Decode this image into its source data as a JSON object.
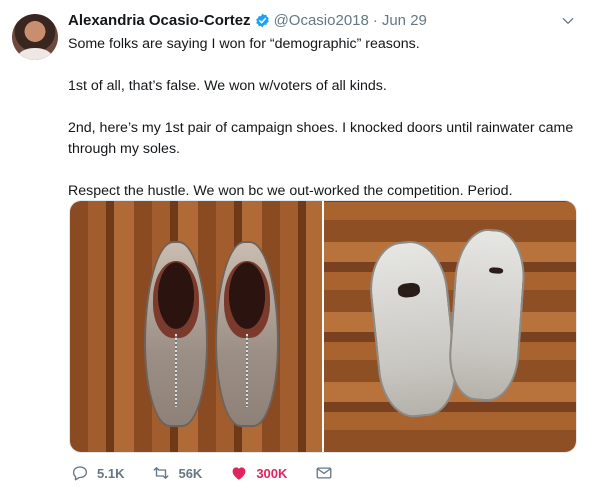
{
  "tweet": {
    "author_name": "Alexandria Ocasio-Cortez",
    "handle": "@Ocasio2018",
    "separator": "·",
    "date": "Jun 29",
    "paragraphs": [
      "Some folks are saying I won for “demographic” reasons.",
      "1st of all, that’s false. We won w/voters of all kinds.",
      "2nd, here’s my 1st pair of campaign shoes. I knocked doors until rainwater came through my soles.",
      "Respect the hustle. We won bc we out-worked the competition. Period."
    ],
    "media": [
      {
        "icon": "photo-shoes-top"
      },
      {
        "icon": "photo-shoes-soles"
      }
    ],
    "actions": {
      "reply_count": "5.1K",
      "retweet_count": "56K",
      "like_count": "300K"
    },
    "colors": {
      "verified": "#1da1f2",
      "like": "#e0245e",
      "muted": "#657786"
    }
  }
}
